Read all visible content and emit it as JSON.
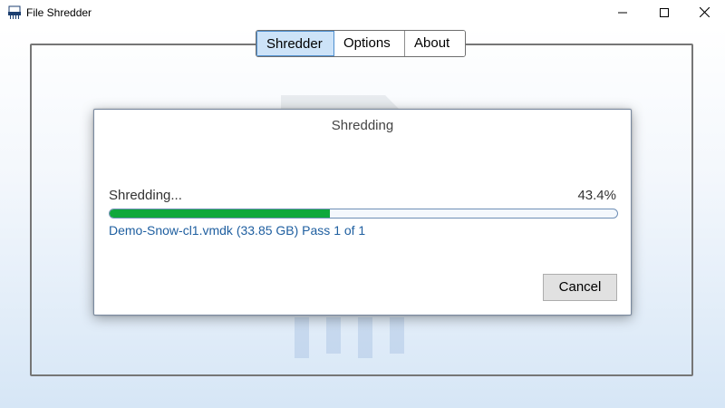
{
  "window": {
    "title": "File Shredder",
    "icon": "shredder-app-icon",
    "controls": [
      "minimize-icon",
      "maximize-icon",
      "close-icon"
    ]
  },
  "tabs": [
    {
      "label": "Shredder",
      "active": true
    },
    {
      "label": "Options",
      "active": false
    },
    {
      "label": "About",
      "active": false
    }
  ],
  "dialog": {
    "title": "Shredding",
    "status": "Shredding...",
    "percent_text": "43.4%",
    "progress_percent": 43.4,
    "file_info": "Demo-Snow-cl1.vmdk (33.85 GB) Pass 1 of 1",
    "cancel_label": "Cancel"
  },
  "colors": {
    "progress_fill": "#0fa83b",
    "active_tab": "#cde3f8",
    "file_info_text": "#1f5fa0"
  }
}
